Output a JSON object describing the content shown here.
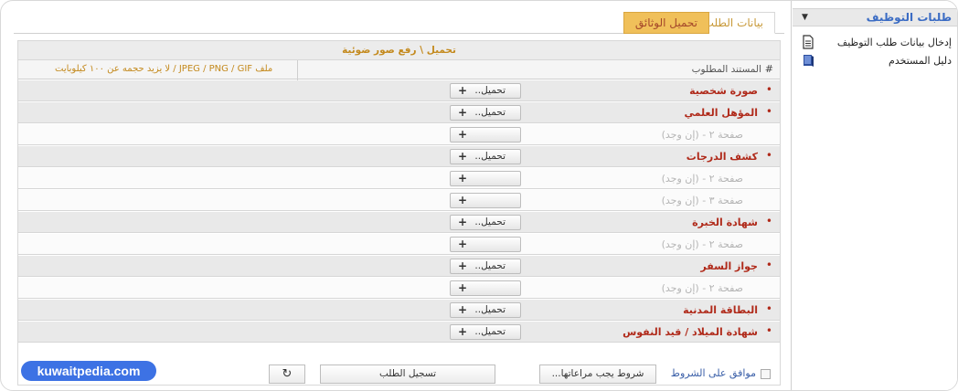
{
  "sidebar": {
    "title": "طلبات التوظيف",
    "items": [
      {
        "label": "إدخال بيانات طلب التوظيف",
        "icon": "document-icon"
      },
      {
        "label": "دليل المستخدم",
        "icon": "book-icon"
      }
    ]
  },
  "tabs": [
    {
      "label": "بيانات الطلب",
      "active": false
    },
    {
      "label": "تحميل الوثائق",
      "active": true
    }
  ],
  "panel": {
    "caption": "تحميل \\ رفع صور ضوئية",
    "header": {
      "hash": "#",
      "document": "المستند المطلوب",
      "file_note": "ملف JPEG / PNG / GIF / لا يزيد حجمه عن ١٠٠ كيلوبايت"
    },
    "upload_label": "تحميل..",
    "rows": [
      {
        "type": "main",
        "label": "صورة شخصية"
      },
      {
        "type": "main",
        "label": "المؤهل العلمي"
      },
      {
        "type": "sub",
        "label": "صفحة ٢ - (إن وجد)"
      },
      {
        "type": "main",
        "label": "كشف الدرجات"
      },
      {
        "type": "sub",
        "label": "صفحة ٢ - (إن وجد)"
      },
      {
        "type": "sub",
        "label": "صفحة ٣ - (إن وجد)"
      },
      {
        "type": "main",
        "label": "شهادة الخبرة"
      },
      {
        "type": "sub",
        "label": "صفحة ٢ - (إن وجد)"
      },
      {
        "type": "main",
        "label": "جواز السفر"
      },
      {
        "type": "sub",
        "label": "صفحة ٢ - (إن وجد)"
      },
      {
        "type": "main",
        "label": "البطاقة المدنية"
      },
      {
        "type": "main",
        "label": "شهادة الميلاد / قيد النفوس"
      }
    ]
  },
  "footer": {
    "agree_label": "موافق على الشروط",
    "terms_button": "شروط يجب مراعاتها...",
    "submit_button": "تسجيل الطلب",
    "reset_icon": "refresh-icon",
    "reset_glyph": "↻"
  },
  "watermark": "kuwaitpedia.com",
  "colors": {
    "accent": "#b02a1a",
    "tab_active": "#f0c05a",
    "brand": "#3d72e4",
    "link": "#3b6cc4"
  }
}
